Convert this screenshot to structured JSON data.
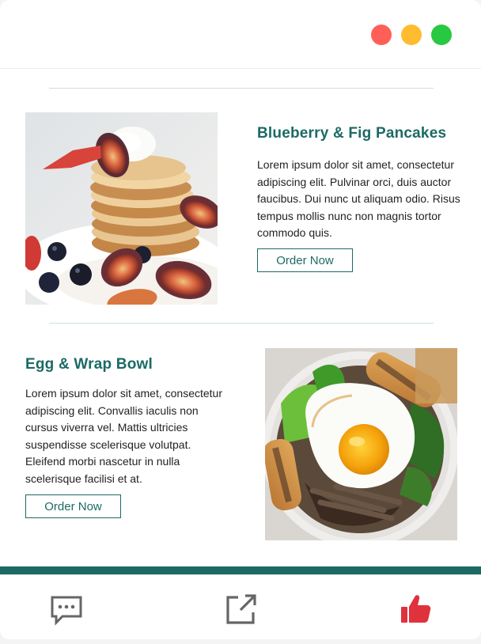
{
  "colors": {
    "accent": "#1c6a64",
    "close_dot": "#ff5f57",
    "minimize_dot": "#febc2e",
    "maximize_dot": "#28c840",
    "like": "#e0323c",
    "footer_icon": "#666666"
  },
  "window_controls": [
    "close-dot",
    "minimize-dot",
    "maximize-dot"
  ],
  "items": [
    {
      "title": "Blueberry & Fig Pancakes",
      "description": "Lorem ipsum dolor sit amet, consectetur adipiscing elit. Pulvinar orci, duis auctor faucibus. Dui nunc ut aliquam odio. Risus tempus mollis nunc non magnis tortor commodo quis.",
      "button": "Order Now"
    },
    {
      "title": "Egg & Wrap Bowl",
      "description": "Lorem ipsum dolor sit amet, consectetur adipiscing elit. Convallis iaculis non cursus viverra vel. Mattis ultricies suspendisse scelerisque volutpat. Eleifend morbi nascetur in nulla scelerisque facilisi et at.",
      "button": "Order Now"
    }
  ],
  "footer": {
    "icons": [
      "chat-icon",
      "share-icon",
      "thumbs-up-icon"
    ]
  }
}
